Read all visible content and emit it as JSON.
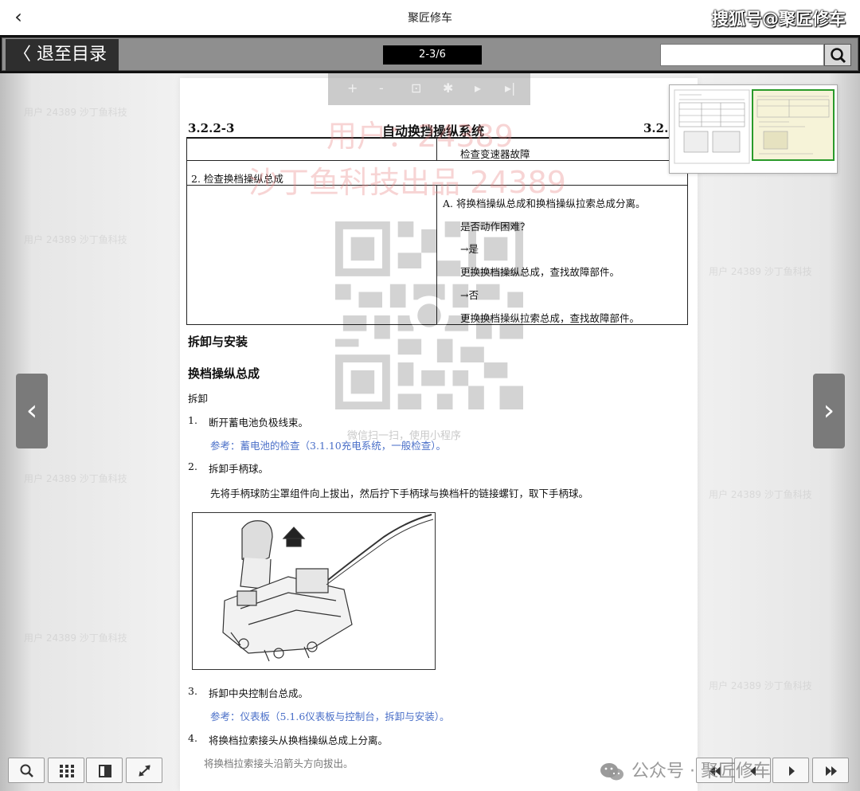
{
  "topbar": {
    "title": "聚匠修车",
    "watermark": "搜狐号@聚匠修车"
  },
  "toolbar": {
    "exit_label": "〈 退至目录",
    "page_indicator": "2-3/6",
    "search_placeholder": ""
  },
  "zoom_strip": {
    "items": [
      "+",
      "-",
      "⊡",
      "✱",
      "▸",
      "▸|"
    ]
  },
  "document": {
    "section_left": "3.2.2-3",
    "section_title": "自动换挡操纵系统",
    "section_right": "3.2.2",
    "watermark_user": "用户：24389",
    "watermark_brand": "沙丁鱼科技出品 24389",
    "table": {
      "r1_right": "检查变速器故障",
      "r2_left": "2. 检查换档操纵总成",
      "step_a": "A. 将换档操纵总成和换档操纵拉索总成分离。",
      "question": "是否动作困难？",
      "yes": "→是",
      "yes_action": "更换换档操纵总成，查找故障部件。",
      "no": "→否",
      "no_action": "更换换档操纵拉索总成，查找故障部件。"
    },
    "heading_remove_install": "拆卸与安装",
    "heading_assembly": "换档操纵总成",
    "sub_remove": "拆卸",
    "step1_num": "1.",
    "step1": "断开蓄电池负极线束。",
    "step1_ref": "参考：蓄电池的检查（3.1.10充电系统，一般检查）。",
    "step2_num": "2.",
    "step2": "拆卸手柄球。",
    "step2_detail": "先将手柄球防尘罩组件向上拔出，然后拧下手柄球与换档杆的链接螺钉，取下手柄球。",
    "step3_num": "3.",
    "step3": "拆卸中央控制台总成。",
    "step3_ref": "参考：仪表板（5.1.6仪表板与控制台，拆卸与安装）。",
    "step4_num": "4.",
    "step4": "将换档拉索接头从换档操纵总成上分离。",
    "step4_detail": "将换档拉索接头沿箭头方向拔出。",
    "qr_caption": "微信扫一扫，使用小程序",
    "bg_watermark_text": "用户 24389 沙丁鱼科技"
  },
  "bottom": {
    "watermark": "公众号 · 聚匠修车"
  },
  "colors": {
    "link": "#4a6fc8",
    "thumb_border": "#2a9a2a",
    "toolbar": "#8f8f8f"
  }
}
